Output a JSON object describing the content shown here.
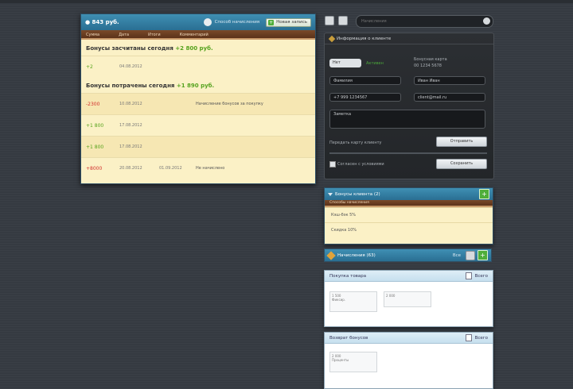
{
  "ledger": {
    "title": "● 843 руб.",
    "settings_link": "Способ начисления",
    "add_button": "Новая запись",
    "tabs": [
      "Сумма",
      "Дата",
      "Итоги",
      "Комментарий"
    ],
    "income_label": "Бонусы засчитаны сегодня",
    "income_value": "+2 800 руб.",
    "expense_label": "Бонусы потрачены сегодня",
    "expense_value": "+1 890 руб.",
    "rows": [
      {
        "amount": "+2",
        "kind": "green",
        "date": "04.08.2012",
        "extra": "",
        "comment": ""
      },
      {
        "amount": "-2300",
        "kind": "red",
        "date": "10.08.2012",
        "extra": "",
        "comment": "Начисление бонусов за покупку"
      },
      {
        "amount": "+1 800",
        "kind": "green",
        "date": "17.08.2012",
        "extra": "",
        "comment": ""
      },
      {
        "amount": "+1 800",
        "kind": "green",
        "date": "17.08.2012",
        "extra": "",
        "comment": ""
      },
      {
        "amount": "+8000",
        "kind": "red",
        "date": "20.08.2012",
        "extra": "01.09.2012",
        "comment": "Не начислено"
      }
    ]
  },
  "search": {
    "placeholder": "Начисления"
  },
  "form": {
    "title": "Информация о клиенте",
    "toggle_label": "Нет",
    "status_ok": "Активен",
    "card_label": "Бонусная карта",
    "card_number": "00 1234 5678",
    "field_name": "Фамилия",
    "field_firstname": "Иван Иван",
    "field_phone": "+7 999 1234567",
    "field_email": "client@mail.ru",
    "comment_placeholder": "Заметка",
    "send_label": "Передать карту клиенту",
    "send_button": "Отправить",
    "check_label": "Согласен с условиями",
    "save_button": "Сохранить"
  },
  "widget": {
    "title": "Бонусы клиента (2)",
    "tab": "Способы начисления",
    "items": [
      "Кэш-бэк 5%",
      "Скидка 10%"
    ]
  },
  "catalog": {
    "title": "Начисления (63)",
    "filter_label": "Все",
    "cards": [
      {
        "title": "Покупка товара",
        "meta": "Всего",
        "lines": [
          "1 500",
          "Фиксир.",
          "2 000"
        ]
      },
      {
        "title": "Возврат бонусов",
        "meta": "Всего",
        "lines": [
          "2 000",
          "Проценты",
          "1 000"
        ]
      }
    ]
  }
}
